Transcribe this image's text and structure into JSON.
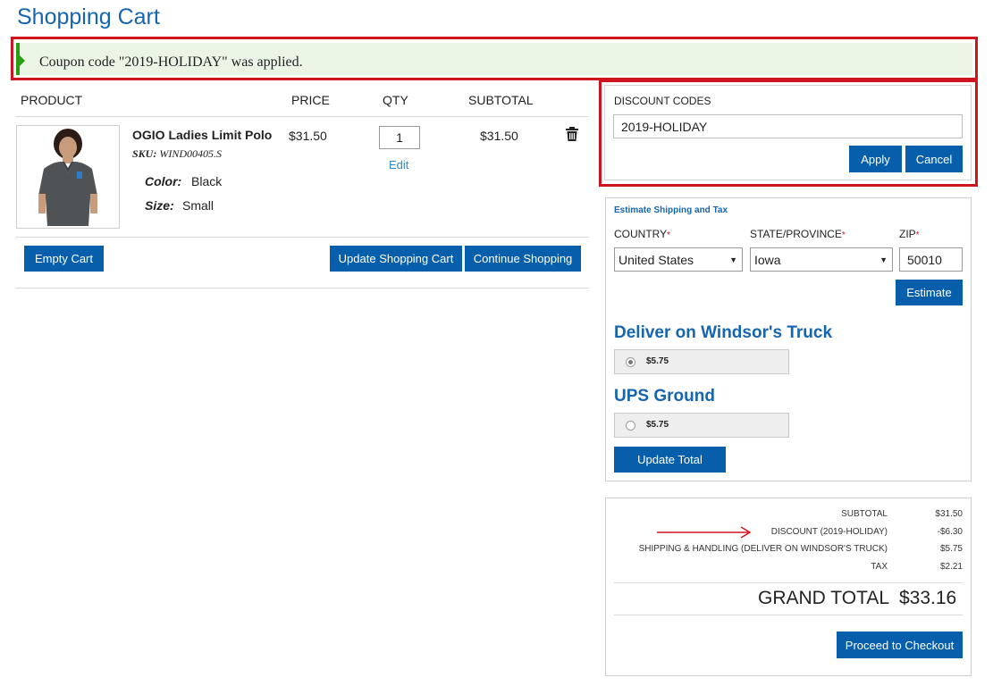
{
  "page": {
    "title": "Shopping Cart"
  },
  "notice": {
    "message": "Coupon code \"2019-HOLIDAY\" was applied.",
    "color": "#2a9d13"
  },
  "cart": {
    "columns": {
      "product": "PRODUCT",
      "price": "PRICE",
      "qty": "QTY",
      "subtotal": "SUBTOTAL"
    },
    "item": {
      "name": "OGIO Ladies Limit Polo",
      "sku_label": "SKU:",
      "sku_value": "WIND00405.S",
      "color_label": "Color:",
      "color_value": "Black",
      "size_label": "Size:",
      "size_value": "Small",
      "price": "$31.50",
      "qty": "1",
      "edit_label": "Edit",
      "subtotal": "$31.50"
    },
    "buttons": {
      "empty": "Empty Cart",
      "update": "Update Shopping Cart",
      "continue": "Continue Shopping"
    }
  },
  "discount": {
    "label": "DISCOUNT CODES",
    "code": "2019-HOLIDAY",
    "apply": "Apply",
    "cancel": "Cancel"
  },
  "shipping": {
    "title": "Estimate Shipping and Tax",
    "country_label": "COUNTRY",
    "country_value": "United States",
    "state_label": "STATE/PROVINCE",
    "state_value": "Iowa",
    "zip_label": "ZIP",
    "zip_value": "50010",
    "required_mark": "*",
    "estimate": "Estimate",
    "methods": [
      {
        "title": "Deliver on Windsor's Truck",
        "price": "$5.75",
        "selected": true
      },
      {
        "title": "UPS Ground",
        "price": "$5.75",
        "selected": false
      }
    ],
    "update_total": "Update Total"
  },
  "totals": {
    "rows": [
      {
        "label": "SUBTOTAL",
        "value": "$31.50"
      },
      {
        "label": "DISCOUNT (2019-HOLIDAY)",
        "value": "-$6.30"
      },
      {
        "label": "SHIPPING & HANDLING (DELIVER ON WINDSOR'S TRUCK)",
        "value": "$5.75"
      },
      {
        "label": "TAX",
        "value": "$2.21"
      }
    ],
    "grand_total_label": "GRAND TOTAL",
    "grand_total_value": "$33.16",
    "checkout": "Proceed to Checkout"
  },
  "colors": {
    "brand_blue": "#075fac",
    "title_blue": "#1565b0",
    "highlight_red": "#d0131f"
  }
}
